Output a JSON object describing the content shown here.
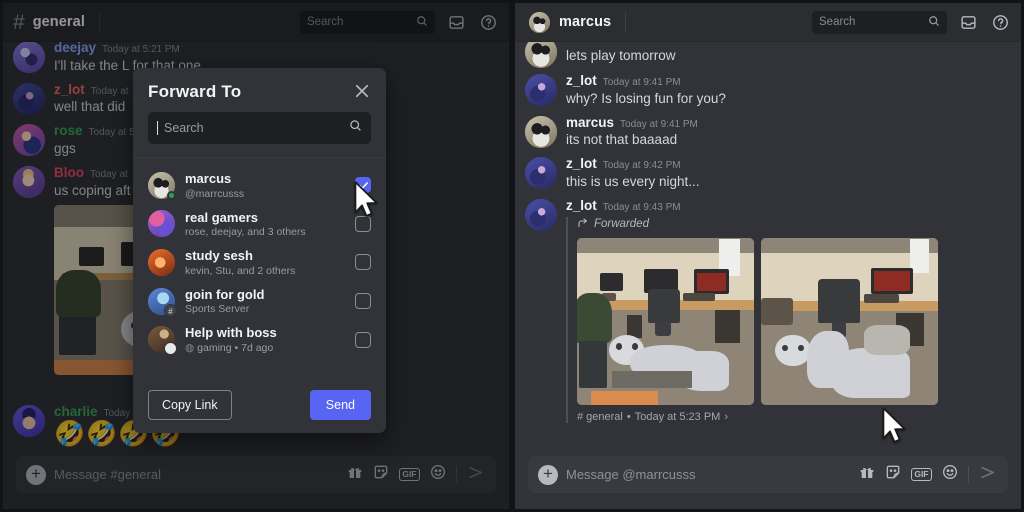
{
  "left_panel": {
    "header": {
      "hash_icon": "hash-icon",
      "channel_name": "general",
      "search_placeholder": "Search",
      "search_icon": "search-icon",
      "inbox_icon": "inbox-icon",
      "help_icon": "help-icon"
    },
    "messages": [
      {
        "author": "deejay",
        "author_color": "#8aa9ff",
        "time": "Today at 5:21 PM",
        "text": "I'll take the L for that one"
      },
      {
        "author": "z_lot",
        "author_color": "#ed6a68",
        "time": "Today at",
        "text": "well that did"
      },
      {
        "author": "rose",
        "author_color": "#3ba55d",
        "time": "Today at 5",
        "text": "ggs"
      },
      {
        "author": "Bloo",
        "author_color": "#ed4a6a",
        "time": "Today at",
        "text": "us coping aft"
      },
      {
        "author": "charlie",
        "author_color": "#3ba55d",
        "time": "Today",
        "text": "🤣🤣🤣🤣"
      }
    ],
    "composer": {
      "plus_icon": "plus-icon",
      "placeholder": "Message #general",
      "gift_icon": "gift-icon",
      "sticker_icon": "sticker-icon",
      "gif_label": "GIF",
      "emoji_icon": "emoji-icon",
      "send_icon": "send-icon"
    }
  },
  "modal": {
    "title": "Forward To",
    "close_icon": "close-icon",
    "search_placeholder": "Search",
    "search_icon": "search-icon",
    "items": [
      {
        "name": "marcus",
        "subtitle": "@marrcusss",
        "checked": true,
        "avatar_color": "#a89d7e",
        "badge": "",
        "online": true
      },
      {
        "name": "real gamers",
        "subtitle": "rose, deejay, and 3 others",
        "checked": false,
        "avatar_color": "#8a5cc4",
        "badge": "",
        "online": false
      },
      {
        "name": "study sesh",
        "subtitle": "kevin, Stu, and 2 others",
        "checked": false,
        "avatar_color": "#d1571f",
        "badge": "",
        "online": false
      },
      {
        "name": "goin for gold",
        "subtitle": "Sports Server",
        "checked": false,
        "avatar_color": "#4f7ccf",
        "badge": "#",
        "online": false
      },
      {
        "name": "Help with boss",
        "subtitle": "gaming • 7d ago",
        "checked": false,
        "avatar_color": "#6b4a38",
        "badge": "💬",
        "online": false
      }
    ],
    "copy_link_label": "Copy Link",
    "send_label": "Send",
    "accent_color": "#5865f2"
  },
  "right_panel": {
    "header": {
      "dm_name": "marcus",
      "search_placeholder": "Search",
      "search_icon": "search-icon",
      "inbox_icon": "inbox-icon",
      "help_icon": "help-icon"
    },
    "messages": [
      {
        "author": "",
        "author_color": "#ffffff",
        "time": "",
        "text": "lets play tomorrow"
      },
      {
        "author": "z_lot",
        "author_color": "#f2f3f5",
        "time": "Today at 9:41 PM",
        "text": "why? Is losing fun for you?"
      },
      {
        "author": "marcus",
        "author_color": "#f2f3f5",
        "time": "Today at 9:41 PM",
        "text": "its not that baaaad"
      },
      {
        "author": "z_lot",
        "author_color": "#f2f3f5",
        "time": "Today at 9:42 PM",
        "text": "this is us every night..."
      }
    ],
    "forwarded_message": {
      "author": "z_lot",
      "time": "Today at 9:43 PM",
      "forwarded_label": "Forwarded",
      "forward_icon": "forward-arrow-icon",
      "footer_channel": "# general",
      "footer_sep": "•",
      "footer_time": "Today at 5:23 PM",
      "footer_chevron": "›"
    },
    "composer": {
      "plus_icon": "plus-icon",
      "placeholder": "Message @marrcusss",
      "gift_icon": "gift-icon",
      "sticker_icon": "sticker-icon",
      "gif_label": "GIF",
      "emoji_icon": "emoji-icon",
      "send_icon": "send-icon"
    }
  }
}
